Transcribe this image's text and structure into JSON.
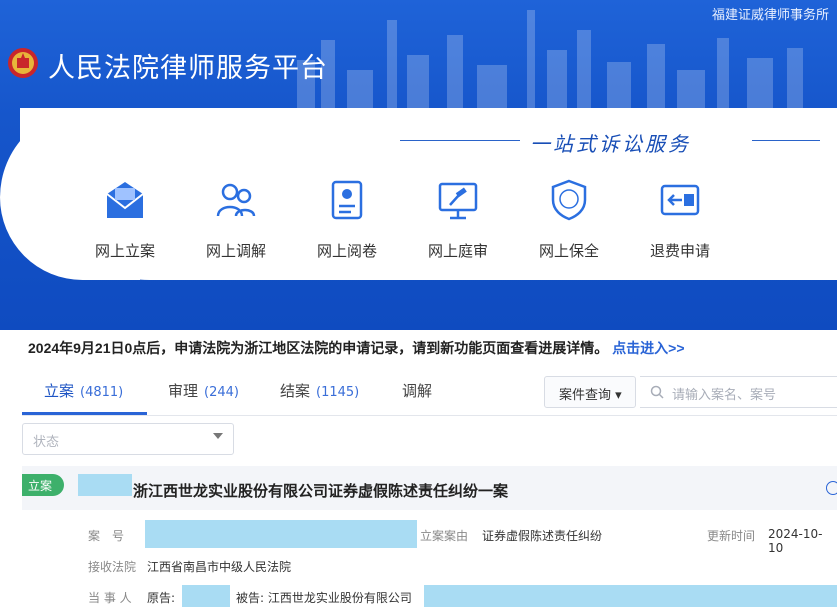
{
  "header": {
    "firm": "福建证威律师事务所",
    "title": "人民法院律师服务平台",
    "slogan": "一站式诉讼服务",
    "services": [
      {
        "label": "网上立案",
        "icon": "envelope-icon"
      },
      {
        "label": "网上调解",
        "icon": "people-icon"
      },
      {
        "label": "网上阅卷",
        "icon": "document-icon"
      },
      {
        "label": "网上庭审",
        "icon": "gavel-screen-icon"
      },
      {
        "label": "网上保全",
        "icon": "shield-icon"
      },
      {
        "label": "退费申请",
        "icon": "refund-icon"
      }
    ]
  },
  "notice": {
    "text": "2024年9月21日0点后，申请法院为浙江地区法院的申请记录，请到新功能页面查看进展详情。",
    "link": "点击进入>>"
  },
  "tabs": [
    {
      "label": "立案",
      "count": "(4811)"
    },
    {
      "label": "审理",
      "count": "(244)"
    },
    {
      "label": "结案",
      "count": "(1145)"
    },
    {
      "label": "调解",
      "count": ""
    }
  ],
  "query": {
    "dropdown_label": "案件查询",
    "search_placeholder": "请输入案名、案号",
    "status_placeholder": "状态"
  },
  "case": {
    "badge": "立案",
    "title": "浙江西世龙实业股份有限公司证券虚假陈述责任纠纷一案",
    "case_no_label": "案　号",
    "cause_label": "立案案由",
    "cause_value": "证券虚假陈述责任纠纷",
    "updated_label": "更新时间",
    "updated_value": "2024-10-10",
    "court_label": "接收法院",
    "court_value": "江西省南昌市中级人民法院",
    "party_label": "当 事 人",
    "plaintiff_label": "原告:",
    "defendant_text": "被告: 江西世龙实业股份有限公司"
  },
  "colors": {
    "brand_blue": "#1656cb",
    "accent": "#2a64d6",
    "badge_green": "#3db06b",
    "redaction": "#a9dcf3"
  }
}
